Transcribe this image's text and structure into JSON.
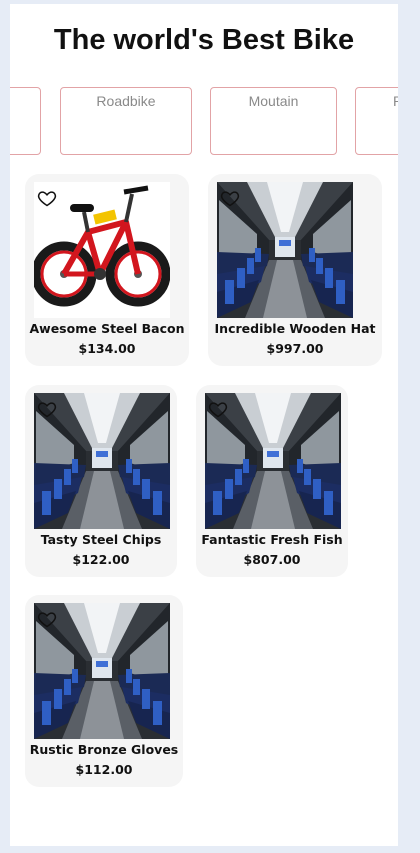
{
  "header": {
    "title": "The world's Best Bike"
  },
  "categories": [
    {
      "label": ""
    },
    {
      "label": "Roadbike"
    },
    {
      "label": "Moutain"
    },
    {
      "label": "P"
    }
  ],
  "products": [
    {
      "name": "Awesome Steel Bacon",
      "price": "$134.00",
      "image": "red-fat-tire-bike-photo"
    },
    {
      "name": "Incredible Wooden Hat",
      "price": "$997.00",
      "image": "train-interior-photo"
    },
    {
      "name": "Tasty Steel Chips",
      "price": "$122.00",
      "image": "train-interior-photo"
    },
    {
      "name": "Fantastic Fresh Fish",
      "price": "$807.00",
      "image": "train-interior-photo"
    },
    {
      "name": "Rustic Bronze Gloves",
      "price": "$112.00",
      "image": "train-interior-photo"
    }
  ],
  "icons": {
    "favorite": "heart-outline-icon"
  },
  "colors": {
    "page_bg": "#e6ecf6",
    "card_bg": "#f5f5f5",
    "category_border": "#e2a3a6",
    "category_text": "#8a8a8a"
  }
}
